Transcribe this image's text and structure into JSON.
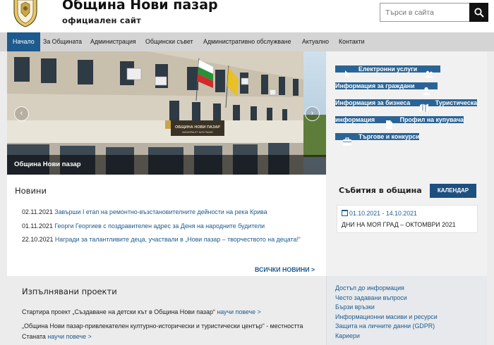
{
  "header": {
    "title": "Община Нови пазар",
    "subtitle": "официален сайт",
    "search_placeholder": "Търси в сайта"
  },
  "nav": [
    {
      "label": "Начало",
      "active": true
    },
    {
      "label": "За Общината"
    },
    {
      "label": "Администрация"
    },
    {
      "label": "Общински съвет"
    },
    {
      "label": "Административно обслужване"
    },
    {
      "label": "Актуално"
    },
    {
      "label": "Контакти"
    }
  ],
  "hero": {
    "caption": "Община Нови пазар",
    "prev_arrow": "‹",
    "next_arrow": "›",
    "building_sign": "ОБЩИНА НОВИ ПАЗАР",
    "building_sign_sub": "MUNICIPALITY NOVI PAZAR"
  },
  "quick_links": [
    {
      "label": "Електронни услуги",
      "icon": "cursor-icon"
    },
    {
      "label": "Информация за граждани",
      "icon": "users-icon"
    },
    {
      "label": "Информация за бизнеса",
      "icon": "user-icon"
    },
    {
      "label": "Туристическа информация",
      "icon": "map-icon"
    },
    {
      "label": "Профил на купувача",
      "icon": "document-icon"
    },
    {
      "label": "Търгове и конкурси",
      "icon": "briefcase-icon"
    }
  ],
  "events": {
    "title": "Събития в община",
    "calendar_label": "КАЛЕНДАР",
    "items": [
      {
        "date": "01.10.2021 - 14.10.2021",
        "name": "ДНИ НА МОЯ ГРАД – ОКТОМВРИ 2021"
      }
    ]
  },
  "news": {
    "title": "Новини",
    "all_label": "ВСИЧКИ НОВИНИ >",
    "items": [
      {
        "date": "02.11.2021",
        "text": "Завърши I етап на ремонтно-възстановителните дейности на река Крива"
      },
      {
        "date": "01.11.2021",
        "text": "Георги Георгиев с поздравителен адрес за Деня на народните будители"
      },
      {
        "date": "22.10.2021",
        "text": "Награди за талантливите деца, участвали в „Нови пазар – творчеството на децата!“"
      }
    ]
  },
  "projects": {
    "title": "Изпълнявани проекти",
    "items": [
      {
        "text": "Стартира проект „Създаване на детски кът в Община Нови пазар“",
        "more": "научи повече >"
      },
      {
        "text": "„Община Нови пазар-привлекателен културно-исторически и туристически център“ - местността Станата",
        "more": "научи повече >"
      }
    ]
  },
  "side_links": [
    "Достъп до информация",
    "Често задавани въпроси",
    "Бързи връзки",
    "Информационни масиви и ресурси",
    "Защита на личните данни (GDPR)",
    "Кариери"
  ],
  "colors": {
    "primary": "#1d5b8e",
    "quick_link_bg": "#2a6496",
    "nav_bg": "#d4d4d4"
  }
}
